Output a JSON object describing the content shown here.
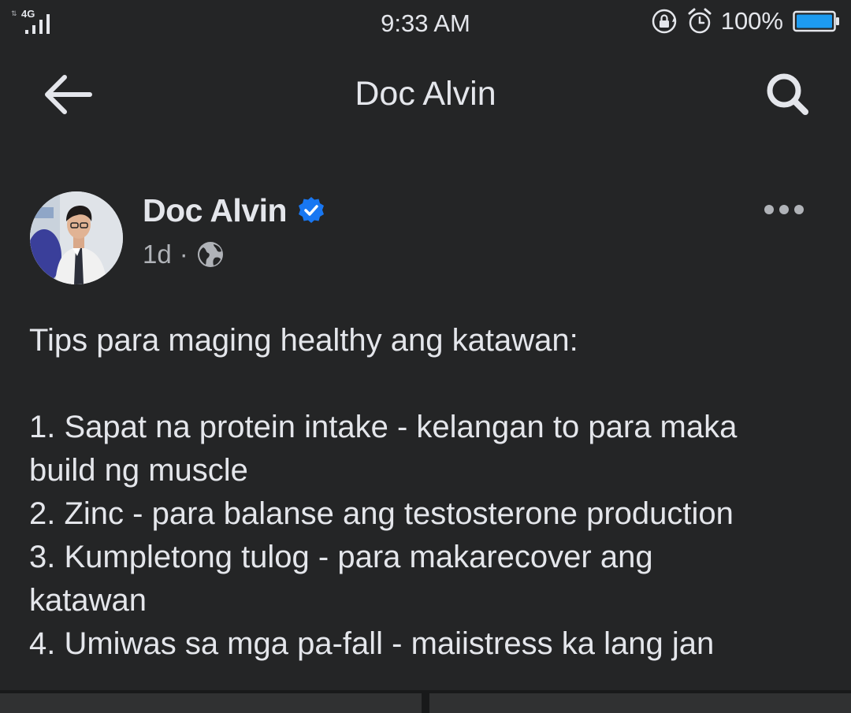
{
  "status_bar": {
    "network": "4G",
    "time": "9:33 AM",
    "battery_percent": "100%"
  },
  "header": {
    "title": "Doc Alvin",
    "back_icon": "arrow-left-icon",
    "search_icon": "search-icon"
  },
  "post": {
    "author": "Doc Alvin",
    "verified": true,
    "time": "1d",
    "separator": "·",
    "audience_icon": "globe-icon",
    "lines": [
      "Tips para maging healthy ang katawan:",
      "",
      "1. Sapat na protein intake - kelangan to para maka",
      "build ng muscle",
      "2. Zinc - para balanse ang testosterone production",
      "3. Kumpletong tulog - para makarecover ang",
      "katawan",
      "4. Umiwas sa mga pa-fall - maiistress ka lang jan"
    ]
  },
  "colors": {
    "background": "#242526",
    "text_primary": "#e4e6eb",
    "text_secondary": "#b0b3b8",
    "verified_blue": "#1877f2",
    "battery_blue": "#1d9bf0"
  }
}
